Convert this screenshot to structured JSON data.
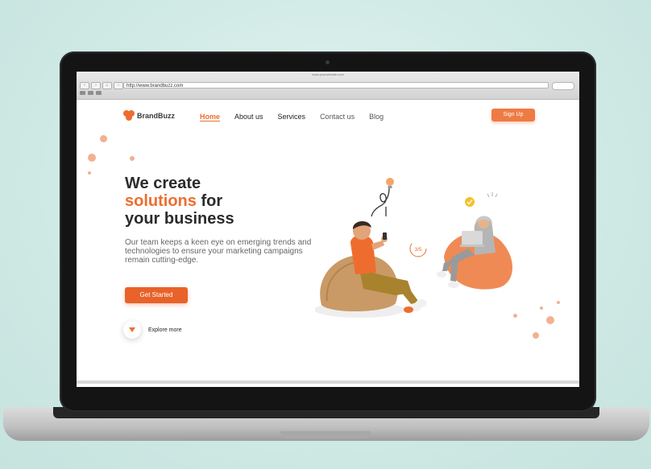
{
  "browser": {
    "window_title": "www.yourwebsite.com",
    "url": "http://www.brandbuzz.com"
  },
  "brand": {
    "name": "BrandBuzz",
    "accent_color": "#ee6d2e"
  },
  "nav": {
    "items": [
      {
        "label": "Home",
        "active": true
      },
      {
        "label": "About us"
      },
      {
        "label": "Services"
      },
      {
        "label": "Contact us"
      },
      {
        "label": "Blog"
      }
    ],
    "signup_label": "Sign Up"
  },
  "hero": {
    "line1": "We create",
    "line2_accent": "solutions",
    "line2_rest": " for",
    "line3": "your business",
    "subtitle": "Our team keeps a keen eye on emerging trends and technologies to ensure your marketing campaigns remain cutting-edge.",
    "cta_label": "Get Started",
    "explore_label": "Explore more"
  },
  "illustration": {
    "progress_label": "3/5"
  }
}
